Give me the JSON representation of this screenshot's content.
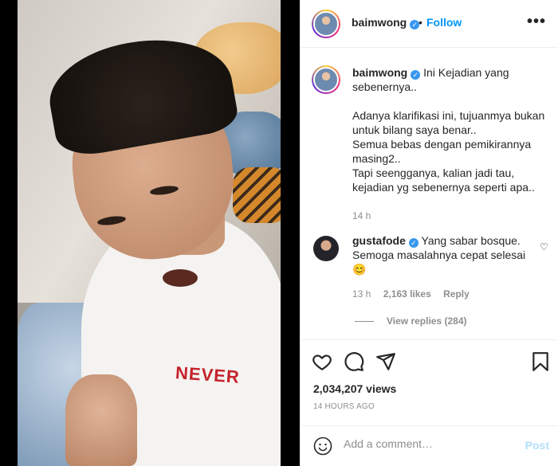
{
  "post": {
    "username": "baimwong",
    "follow_label": "Follow",
    "more_label": "•••",
    "caption_lines": [
      "Ini Kejadian yang",
      "sebenernya.."
    ],
    "caption_body": [
      "Adanya klarifikasi ini, tujuanmya bukan",
      "untuk bilang saya benar..",
      "Semua bebas dengan pemikirannya",
      "masing2..",
      "Tapi seengganya, kalian jadi tau,",
      "kejadian yg sebenernya seperti apa.."
    ],
    "caption_time": "14 h",
    "shirt_text": "NEVER"
  },
  "comment": {
    "username": "gustafode",
    "text_line1": "Yang sabar bosque.",
    "text_line2": "Semoga masalahnya cepat selesai",
    "emoji": "😊",
    "time": "13 h",
    "likes": "2,163 likes",
    "reply_label": "Reply",
    "view_replies": "View replies (284)"
  },
  "stats": {
    "views": "2,034,207 views",
    "posted": "14 HOURS AGO"
  },
  "add_comment": {
    "placeholder": "Add a comment…",
    "post_label": "Post"
  },
  "icons": [
    "heart-icon",
    "comment-icon",
    "share-icon",
    "bookmark-icon",
    "emoji-icon",
    "verified-icon",
    "more-icon"
  ],
  "colors": {
    "link_blue": "#0095f6",
    "post_disabled": "#b2dffc",
    "muted": "#8e8e8e",
    "verified": "#3897f0"
  }
}
